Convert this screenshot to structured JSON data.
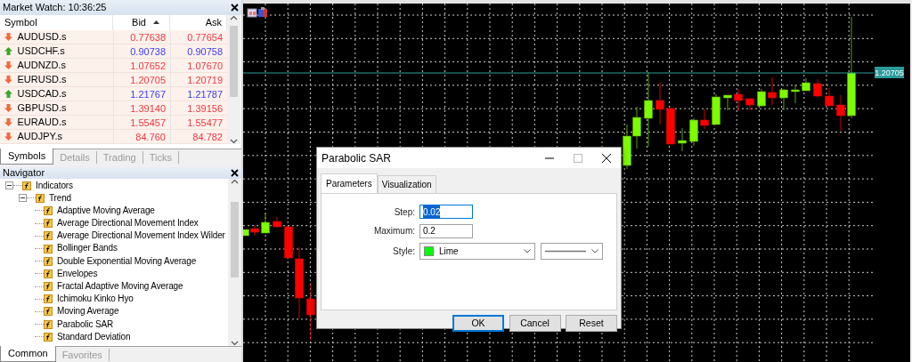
{
  "market_watch": {
    "title": "Market Watch: 10:36:25",
    "columns": [
      {
        "label": "Symbol",
        "sorted": false
      },
      {
        "label": "Bid",
        "sorted": true
      },
      {
        "label": "Ask",
        "sorted": false
      }
    ],
    "rows": [
      {
        "symbol": "AUDUSD.s",
        "bid": "0.77638",
        "ask": "0.77654",
        "rising": false
      },
      {
        "symbol": "USDCHF.s",
        "bid": "0.90738",
        "ask": "0.90758",
        "rising": true
      },
      {
        "symbol": "AUDNZD.s",
        "bid": "1.07652",
        "ask": "1.07670",
        "rising": false
      },
      {
        "symbol": "EURUSD.s",
        "bid": "1.20705",
        "ask": "1.20719",
        "rising": false
      },
      {
        "symbol": "USDCAD.s",
        "bid": "1.21767",
        "ask": "1.21787",
        "rising": true
      },
      {
        "symbol": "GBPUSD.s",
        "bid": "1.39140",
        "ask": "1.39156",
        "rising": false
      },
      {
        "symbol": "EURAUD.s",
        "bid": "1.55457",
        "ask": "1.55477",
        "rising": false
      },
      {
        "symbol": "AUDJPY.s",
        "bid": "84.760",
        "ask": "84.782",
        "rising": false
      }
    ],
    "tabs": [
      {
        "label": "Symbols",
        "selected": true
      },
      {
        "label": "Details",
        "selected": false
      },
      {
        "label": "Trading",
        "selected": false
      },
      {
        "label": "Ticks",
        "selected": false
      }
    ]
  },
  "navigator": {
    "title": "Navigator",
    "tree": [
      {
        "label": "Indicators",
        "expanded": true,
        "children": [
          {
            "label": "Trend",
            "expanded": true,
            "children": [
              {
                "label": "Adaptive Moving Average"
              },
              {
                "label": "Average Directional Movement Index"
              },
              {
                "label": "Average Directional Movement Index Wilder"
              },
              {
                "label": "Bollinger Bands"
              },
              {
                "label": "Double Exponential Moving Average"
              },
              {
                "label": "Envelopes"
              },
              {
                "label": "Fractal Adaptive Moving Average"
              },
              {
                "label": "Ichimoku Kinko Hyo"
              },
              {
                "label": "Moving Average"
              },
              {
                "label": "Parabolic SAR"
              },
              {
                "label": "Standard Deviation"
              }
            ]
          }
        ]
      }
    ],
    "tabs": [
      {
        "label": "Common",
        "selected": true
      },
      {
        "label": "Favorites",
        "selected": false
      }
    ]
  },
  "chart": {
    "price_label": "1.20705"
  },
  "dialog": {
    "title": "Parabolic SAR",
    "tabs": [
      {
        "label": "Parameters",
        "selected": true
      },
      {
        "label": "Visualization",
        "selected": false
      }
    ],
    "fields": [
      {
        "kind": "text",
        "label": "Step:",
        "value": "0.02",
        "highlighted": true
      },
      {
        "kind": "text",
        "label": "Maximum:",
        "value": "0.2",
        "highlighted": false
      },
      {
        "kind": "style",
        "label": "Style:",
        "value": "Lime",
        "color": "#00ff00"
      }
    ],
    "buttons": [
      {
        "label": "OK",
        "default": true
      },
      {
        "label": "Cancel",
        "default": false
      },
      {
        "label": "Reset",
        "default": false
      }
    ]
  }
}
